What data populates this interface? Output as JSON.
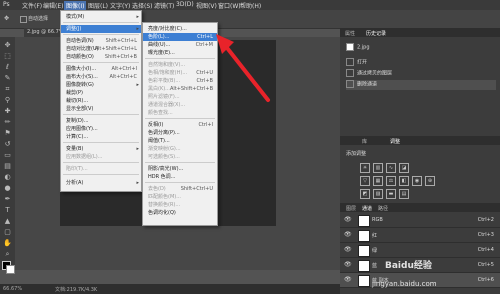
{
  "menubar": {
    "items": [
      "文件(F)",
      "编辑(E)",
      "图像(I)",
      "图层(L)",
      "文字(Y)",
      "选择(S)",
      "滤镜(T)",
      "3D(D)",
      "视图(V)",
      "窗口(W)",
      "帮助(H)"
    ]
  },
  "options": {
    "auto_select": "自动选择"
  },
  "document": {
    "tab": "2.jpg @ 66.7% (RGB/8)"
  },
  "status": {
    "zoom": "66.67%",
    "doc": "文档:219.7K/4.3K"
  },
  "image_menu": {
    "items": [
      {
        "label": "模式(M)",
        "sub": true
      },
      {
        "label": "调整(J)",
        "sub": true,
        "hi": true
      },
      {
        "label": "自动色调(N)",
        "sc": "Shift+Ctrl+L"
      },
      {
        "label": "自动对比度(U)",
        "sc": "Alt+Shift+Ctrl+L"
      },
      {
        "label": "自动颜色(O)",
        "sc": "Shift+Ctrl+B"
      },
      {
        "label": "图像大小(I)...",
        "sc": "Alt+Ctrl+I"
      },
      {
        "label": "画布大小(S)...",
        "sc": "Alt+Ctrl+C"
      },
      {
        "label": "图像旋转(G)",
        "sub": true
      },
      {
        "label": "裁剪(P)"
      },
      {
        "label": "裁切(R)..."
      },
      {
        "label": "显示全部(V)"
      },
      {
        "label": "复制(D)..."
      },
      {
        "label": "应用图像(Y)..."
      },
      {
        "label": "计算(C)..."
      },
      {
        "label": "变量(B)",
        "sub": true
      },
      {
        "label": "应用数据组(L)...",
        "dis": true
      },
      {
        "label": "陷印(T)...",
        "dis": true
      },
      {
        "label": "分析(A)",
        "sub": true
      }
    ]
  },
  "adjust_menu": {
    "items": [
      {
        "label": "亮度/对比度(C)..."
      },
      {
        "label": "色阶(L)...",
        "sc": "Ctrl+L",
        "hi": true
      },
      {
        "label": "曲线(U)...",
        "sc": "Ctrl+M"
      },
      {
        "label": "曝光度(E)..."
      },
      {
        "label": "自然饱和度(V)...",
        "dis": true
      },
      {
        "label": "色相/饱和度(H)...",
        "sc": "Ctrl+U",
        "dis": true
      },
      {
        "label": "色彩平衡(B)...",
        "sc": "Ctrl+B",
        "dis": true
      },
      {
        "label": "黑白(K)...",
        "sc": "Alt+Shift+Ctrl+B",
        "dis": true
      },
      {
        "label": "照片滤镜(F)...",
        "dis": true
      },
      {
        "label": "通道混合器(X)...",
        "dis": true
      },
      {
        "label": "颜色查找...",
        "dis": true
      },
      {
        "label": "反相(I)",
        "sc": "Ctrl+I"
      },
      {
        "label": "色调分离(P)..."
      },
      {
        "label": "阈值(T)..."
      },
      {
        "label": "渐变映射(G)...",
        "dis": true
      },
      {
        "label": "可选颜色(S)...",
        "dis": true
      },
      {
        "label": "阴影/高光(W)..."
      },
      {
        "label": "HDR 色调..."
      },
      {
        "label": "去色(D)",
        "sc": "Shift+Ctrl+U",
        "dis": true
      },
      {
        "label": "匹配颜色(M)...",
        "dis": true
      },
      {
        "label": "替换颜色(R)...",
        "dis": true
      },
      {
        "label": "色调均化(Q)"
      }
    ]
  },
  "panels": {
    "history_tabs": [
      "属性",
      "历史记录"
    ],
    "history_doc": "2.jpg",
    "history_items": [
      "打开",
      "通过拷贝的图层",
      "删除通道"
    ],
    "adjust_tabs": [
      "库",
      "调整"
    ],
    "adjust_title": "添加调整",
    "layers_tabs": [
      "图层",
      "通道",
      "路径"
    ],
    "channels": [
      {
        "name": "RGB",
        "sc": "Ctrl+2"
      },
      {
        "name": "红",
        "sc": "Ctrl+3"
      },
      {
        "name": "绿",
        "sc": "Ctrl+4"
      },
      {
        "name": "蓝",
        "sc": "Ctrl+5"
      },
      {
        "name": "蓝 副本",
        "sc": "Ctrl+6"
      }
    ]
  },
  "watermark": {
    "line1": "Baidu经验",
    "line2": "jingyan.baidu.com"
  },
  "colors": {
    "highlight": "#3d7fd3",
    "arrow": "#e8232a"
  }
}
